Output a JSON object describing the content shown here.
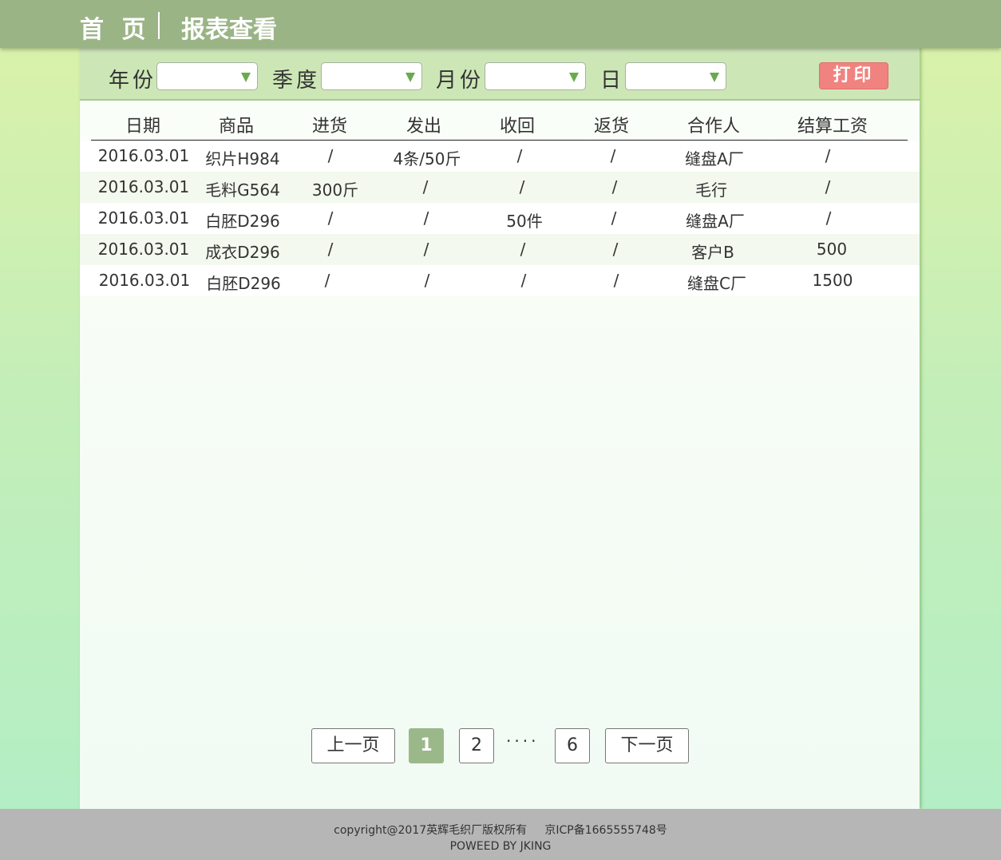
{
  "nav": {
    "home": "首 页",
    "report": "报表查看"
  },
  "filters": {
    "year_label": "年份",
    "season_label": "季度",
    "month_label": "月份",
    "day_label": "日",
    "print_label": "打印"
  },
  "table": {
    "headers": [
      "日期",
      "商品",
      "进货",
      "发出",
      "收回",
      "返货",
      "合作人",
      "结算工资"
    ],
    "rows": [
      [
        "2016.03.01",
        "织片H984",
        "/",
        "4条/50斤",
        "/",
        "/",
        "缝盘A厂",
        "/"
      ],
      [
        "2016.03.01",
        "毛料G564",
        "300斤",
        "/",
        "/",
        "/",
        "毛行",
        "/"
      ],
      [
        "2016.03.01",
        "白胚D296",
        "/",
        "/",
        "50件",
        "/",
        "缝盘A厂",
        "/"
      ],
      [
        "2016.03.01",
        "成衣D296",
        "/",
        "/",
        "/",
        "/",
        "客户B",
        "500"
      ],
      [
        "2016.03.01",
        "白胚D296",
        "/",
        "/",
        "/",
        "/",
        "缝盘C厂",
        "1500"
      ]
    ]
  },
  "pagination": {
    "prev": "上一页",
    "current": "1",
    "page2": "2",
    "ellipsis": "····",
    "last": "6",
    "next": "下一页"
  },
  "footer": {
    "copyright": "copyright@2017英辉毛织厂版权所有     京ICP备1665555748号",
    "powered": "POWEED BY JKING"
  },
  "colors": {
    "topbar": "#9bb486",
    "filterbar": "#cde6b6",
    "print_button": "#f0837f",
    "active_page": "#9bb88a",
    "footer": "#b6b6b6"
  }
}
